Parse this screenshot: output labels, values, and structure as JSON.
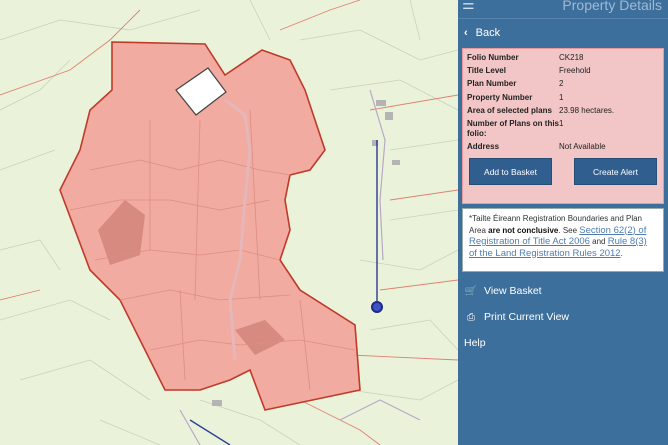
{
  "header": {
    "title": "Property Details",
    "menu_icon": "menu-icon"
  },
  "back": {
    "label": "Back"
  },
  "details": [
    {
      "label": "Folio Number",
      "value": "CK218"
    },
    {
      "label": "Title Level",
      "value": "Freehold"
    },
    {
      "label": "Plan Number",
      "value": "2"
    },
    {
      "label": "Property Number",
      "value": "1"
    },
    {
      "label": "Area of selected plans",
      "value": "23.98 hectares."
    },
    {
      "label": "Number of Plans on this folio:",
      "value": "1"
    },
    {
      "label": "Address",
      "value": "Not Available"
    }
  ],
  "buttons": {
    "add_to_basket": "Add to Basket",
    "create_alert": "Create Alert"
  },
  "note": {
    "prefix": "*Tailte Éireann Registration Boundaries and Plan Area ",
    "emph": "are not conclusive",
    "mid1": ". See ",
    "link1": "Section 62(2) of Registration of Title Act 2006",
    "mid2": " and ",
    "link2": "Rule 8(3) of the Land Registration Rules 2012",
    "suffix": "."
  },
  "nav": {
    "view_basket": "View Basket",
    "print_view": "Print Current View",
    "help": "Help"
  },
  "colors": {
    "panel_bg": "#3d6f9c",
    "details_bg": "#f2c6c6",
    "parcel_fill": "#f1a79d",
    "map_bg": "#eaf3da"
  }
}
